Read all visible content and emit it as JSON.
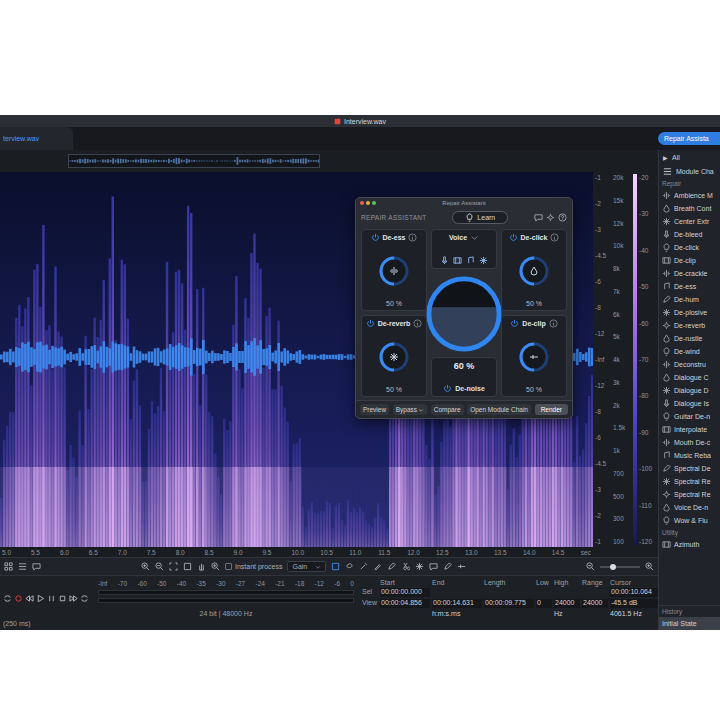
{
  "window": {
    "title": "Interview.wav"
  },
  "file_tab": {
    "label": "terview.wav",
    "selected": true
  },
  "repair_assistant_button": {
    "label": "Repair Assista",
    "selected": true
  },
  "spectrogram": {
    "time_ticks": [
      "5.0",
      "5.5",
      "6.0",
      "6.5",
      "7.0",
      "7.5",
      "8.0",
      "8.5",
      "9.0",
      "9.5",
      "10.0",
      "10.5",
      "11.0",
      "11.5",
      "12.0",
      "12.5",
      "13.0",
      "13.5",
      "14.0",
      "14.5"
    ],
    "time_unit": "sec",
    "amplitude_ticks": [
      "-1",
      "-2",
      "-3",
      "-4.5",
      "-6",
      "-8",
      "-12",
      "-Inf",
      "-12",
      "-8",
      "-6",
      "-4.5",
      "-3",
      "-2",
      "-1"
    ],
    "frequency_ticks": [
      "20k",
      "15k",
      "12k",
      "10k",
      "8k",
      "7k",
      "6k",
      "5k",
      "4k",
      "3k",
      "2k",
      "1.5k",
      "1k",
      "700",
      "500",
      "300",
      "100"
    ],
    "color_ticks": [
      "-20",
      "-30",
      "-40",
      "-50",
      "-60",
      "-70",
      "-80",
      "-90",
      "-100",
      "-110",
      "-120"
    ]
  },
  "toolbar": {
    "instant_process": {
      "label": "Instant process",
      "checked": false
    },
    "mode": "Gain"
  },
  "transport": {
    "zoom_label": "(250 ms)"
  },
  "meter": {
    "ticks": [
      "-Inf",
      "-70",
      "-60",
      "-50",
      "-40",
      "-35",
      "-30",
      "-27",
      "-24",
      "-21",
      "-18",
      "-12",
      "-6",
      "0"
    ],
    "channels": [
      {
        "level": 0
      },
      {
        "level": 0
      }
    ],
    "format": "24 bit | 48000 Hz"
  },
  "info": {
    "columns": [
      "Start",
      "End",
      "Length",
      "Low",
      "High",
      "Range",
      "Cursor"
    ],
    "rows": [
      {
        "label": "Sel",
        "cells": [
          "00:00:00.000",
          "",
          "",
          "",
          "",
          "",
          "00:00:10.064"
        ]
      },
      {
        "label": "View",
        "cells": [
          "00:00:04.856",
          "00:00:14.631",
          "00:00:09.775",
          "0",
          "24000",
          "24000",
          "-45.5 dB"
        ]
      },
      {
        "label": "",
        "cells": [
          "",
          "h:m:s.ms",
          "",
          "",
          "Hz",
          "",
          "4061.5 Hz"
        ]
      }
    ]
  },
  "module_panel": {
    "filter": {
      "icon": "▶",
      "label": "All"
    },
    "chain": "Module Cha",
    "sections": [
      {
        "title": "Repair",
        "items": [
          "Ambience M",
          "Breath Cont",
          "Center Extr",
          "De-bleed",
          "De-click",
          "De-clip",
          "De-crackle",
          "De-ess",
          "De-hum",
          "De-plosive",
          "De-reverb",
          "De-rustle",
          "De-wind",
          "Deconstru",
          "Dialogue C",
          "Dialogue D",
          "Dialogue Is",
          "Guitar De-n",
          "Interpolate",
          "Mouth De-c",
          "Music Reba",
          "Spectral De",
          "Spectral Re",
          "Spectral Re",
          "Voice De-n",
          "Wow & Flu"
        ]
      },
      {
        "title": "Utility",
        "items": [
          "Azimuth"
        ]
      }
    ]
  },
  "history": {
    "title": "History",
    "items": [
      {
        "label": "Initial State",
        "selected": true
      }
    ]
  },
  "dialog": {
    "title": "Repair Assistant",
    "heading": "REPAIR ASSISTANT",
    "learn": "Learn",
    "profile": "Voice",
    "modules": [
      {
        "name": "De-ess",
        "level": 0.5,
        "reading": "50 %",
        "enabled": true
      },
      {
        "name": "De-click",
        "level": 0.5,
        "reading": "50 %",
        "enabled": true
      },
      {
        "name": "De-reverb",
        "level": 0.5,
        "reading": "50 %",
        "enabled": true
      },
      {
        "name": "De-clip",
        "level": 0.5,
        "reading": "50 %",
        "enabled": true
      }
    ],
    "noise": {
      "name": "De-noise",
      "level": 0.6,
      "reading": "60 %",
      "enabled": true
    },
    "buttons": [
      {
        "label": "Preview",
        "kind": "button"
      },
      {
        "label": "Bypass",
        "kind": "dropdown"
      },
      {
        "label": "Compare",
        "kind": "button"
      },
      {
        "label": "Open Module Chain",
        "kind": "button"
      },
      {
        "label": "Render",
        "kind": "primary"
      }
    ]
  }
}
